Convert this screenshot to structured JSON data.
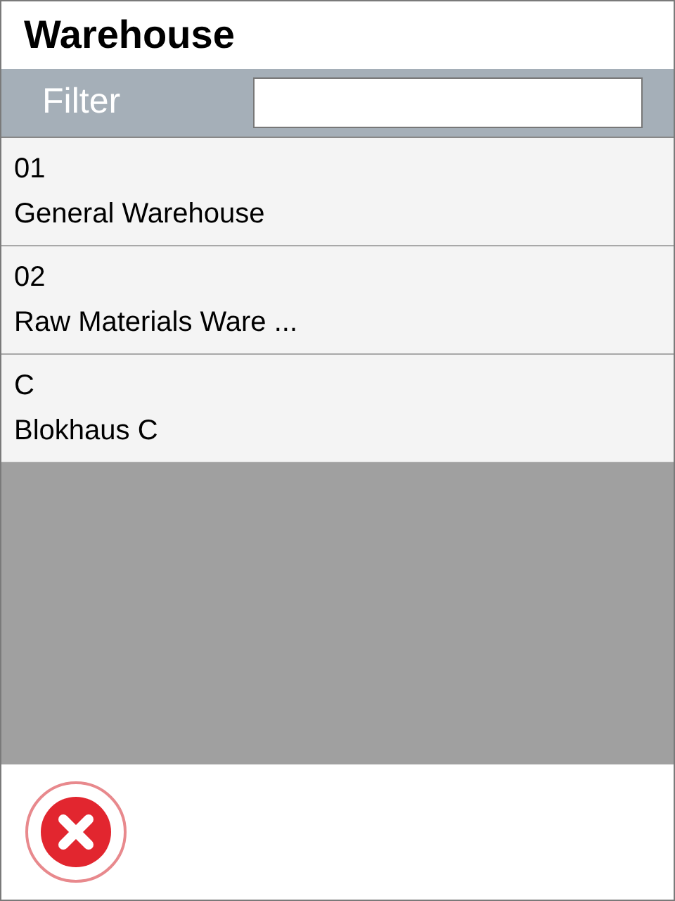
{
  "window": {
    "title": "Warehouse"
  },
  "filter": {
    "label": "Filter"
  },
  "items": [
    {
      "code": "01",
      "name": "General Warehouse"
    },
    {
      "code": "02",
      "name": "Raw Materials Ware ..."
    },
    {
      "code": "C",
      "name": "Blokhaus C"
    }
  ]
}
